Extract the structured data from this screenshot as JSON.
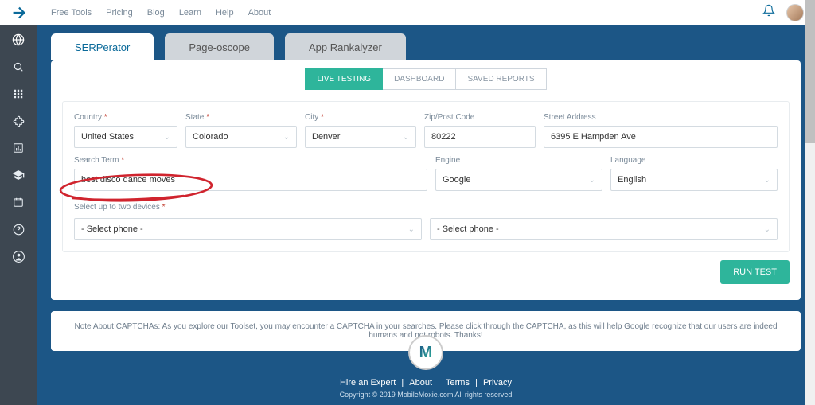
{
  "topnav": {
    "items": [
      "Free Tools",
      "Pricing",
      "Blog",
      "Learn",
      "Help",
      "About"
    ]
  },
  "sidebar": {
    "icons": [
      "globe",
      "search",
      "grid",
      "puzzle",
      "chart",
      "grad-cap",
      "calendar",
      "question",
      "user"
    ]
  },
  "tabs": [
    {
      "label": "SERPerator",
      "active": true
    },
    {
      "label": "Page-oscope",
      "active": false
    },
    {
      "label": "App Rankalyzer",
      "active": false
    }
  ],
  "subtabs": [
    {
      "label": "LIVE TESTING",
      "active": true
    },
    {
      "label": "DASHBOARD",
      "active": false
    },
    {
      "label": "SAVED REPORTS",
      "active": false
    }
  ],
  "form": {
    "country": {
      "label": "Country",
      "required": true,
      "value": "United States"
    },
    "state": {
      "label": "State",
      "required": true,
      "value": "Colorado"
    },
    "city": {
      "label": "City",
      "required": true,
      "value": "Denver"
    },
    "zip": {
      "label": "Zip/Post Code",
      "required": false,
      "value": "80222"
    },
    "street": {
      "label": "Street Address",
      "required": false,
      "value": "6395 E Hampden Ave"
    },
    "search_term": {
      "label": "Search Term",
      "required": true,
      "value": "best disco dance moves"
    },
    "engine": {
      "label": "Engine",
      "required": false,
      "value": "Google"
    },
    "language": {
      "label": "Language",
      "required": false,
      "value": "English"
    },
    "devices_label": "Select up to two devices",
    "devices_required": true,
    "device1": {
      "value": "- Select phone -"
    },
    "device2": {
      "value": "- Select phone -"
    },
    "run_button": "RUN TEST"
  },
  "note": "Note About CAPTCHAs: As you explore our Toolset, you may encounter a CAPTCHA in your searches. Please click through the CAPTCHA, as this will help Google recognize that our users are indeed humans and not robots. Thanks!",
  "footer": {
    "logo_letter": "M",
    "links": [
      "Hire an Expert",
      "About",
      "Terms",
      "Privacy"
    ],
    "copyright": "Copyright © 2019 MobileMoxie.com   All rights reserved"
  }
}
